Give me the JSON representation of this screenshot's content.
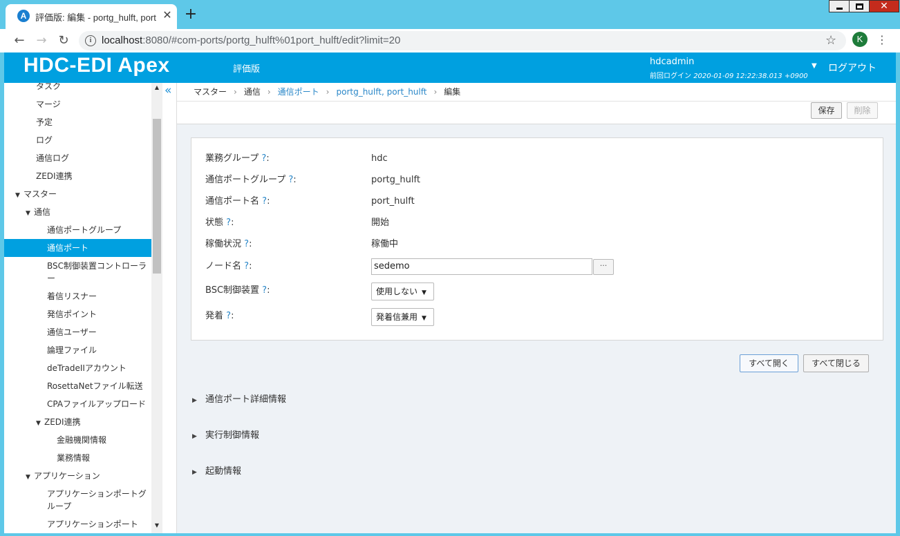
{
  "browser": {
    "tab_title": "評価版: 編集 - portg_hulft, port",
    "favicon_letter": "A",
    "tab_close": "✕",
    "new_tab": "+",
    "win_close": "✕",
    "url_host": "localhost",
    "url_rest": ":8080/#com-ports/portg_hulft%01port_hulft/edit?limit=20",
    "profile_initial": "K",
    "back": "←",
    "forward": "→",
    "reload": "↻",
    "star": "☆",
    "menu": "⋮"
  },
  "header": {
    "brand": "HDC-EDI Apex",
    "trial_label": "評価版",
    "user_name": "hdcadmin",
    "last_login_label": "前回ログイン ",
    "last_login_value": "2020-01-09 12:22:38.013 +0900",
    "caret": "▼",
    "logout": "ログアウト"
  },
  "sidebar": {
    "items": [
      {
        "label": "タスク",
        "level": 2
      },
      {
        "label": "マージ",
        "level": 2
      },
      {
        "label": "予定",
        "level": 2
      },
      {
        "label": "ログ",
        "level": 2
      },
      {
        "label": "通信ログ",
        "level": 2
      },
      {
        "label": "ZEDI連携",
        "level": 2
      },
      {
        "label": "マスター",
        "level": 0,
        "expanded": true
      },
      {
        "label": "通信",
        "level": 1,
        "expanded": true
      },
      {
        "label": "通信ポートグループ",
        "level": 3
      },
      {
        "label": "通信ポート",
        "level": 3,
        "active": true
      },
      {
        "label": "BSC制御装置コントローラー",
        "level": 3,
        "two_line": true
      },
      {
        "label": "着信リスナー",
        "level": 3
      },
      {
        "label": "発信ポイント",
        "level": 3
      },
      {
        "label": "通信ユーザー",
        "level": 3
      },
      {
        "label": "論理ファイル",
        "level": 3
      },
      {
        "label": "deTradeIIアカウント",
        "level": 3
      },
      {
        "label": "RosettaNetファイル転送",
        "level": 3
      },
      {
        "label": "CPAファイルアップロード",
        "level": 3
      },
      {
        "label": "ZEDI連携",
        "level": 2,
        "expanded": true
      },
      {
        "label": "金融機関情報",
        "level": 4
      },
      {
        "label": "業務情報",
        "level": 4
      },
      {
        "label": "アプリケーション",
        "level": 1,
        "expanded": true
      },
      {
        "label": "アプリケーションポートグループ",
        "level": 3,
        "two_line": true
      },
      {
        "label": "アプリケーションポート",
        "level": 3
      }
    ],
    "collapse_icon": "«",
    "scroll_up": "▲",
    "scroll_down": "▼",
    "arrow": "▼"
  },
  "breadcrumb": [
    {
      "label": "マスター",
      "link": false
    },
    {
      "label": "通信",
      "link": false
    },
    {
      "label": "通信ポート",
      "link": true
    },
    {
      "label": "portg_hulft, port_hulft",
      "link": true
    },
    {
      "label": "編集",
      "link": false
    }
  ],
  "breadcrumb_sep": "›",
  "actions": {
    "save": "保存",
    "delete": "削除"
  },
  "form": {
    "help": "?",
    "colon": ":",
    "business_group": {
      "label": "業務グループ",
      "value": "hdc"
    },
    "port_group": {
      "label": "通信ポートグループ",
      "value": "portg_hulft"
    },
    "port_name": {
      "label": "通信ポート名",
      "value": "port_hulft"
    },
    "state": {
      "label": "状態",
      "value": "開始"
    },
    "operation": {
      "label": "稼働状況",
      "value": "稼働中"
    },
    "node_name": {
      "label": "ノード名",
      "value": "sedemo",
      "picker": "···"
    },
    "bsc_device": {
      "label": "BSC制御装置",
      "value": "使用しない"
    },
    "direction": {
      "label": "発着",
      "value": "発着信兼用"
    },
    "select_caret": "▼"
  },
  "buttons": {
    "expand_all": "すべて開く",
    "collapse_all": "すべて閉じる"
  },
  "sections": {
    "triangle": "▶",
    "items": [
      "通信ポート詳細情報",
      "実行制御情報",
      "起動情報"
    ]
  }
}
